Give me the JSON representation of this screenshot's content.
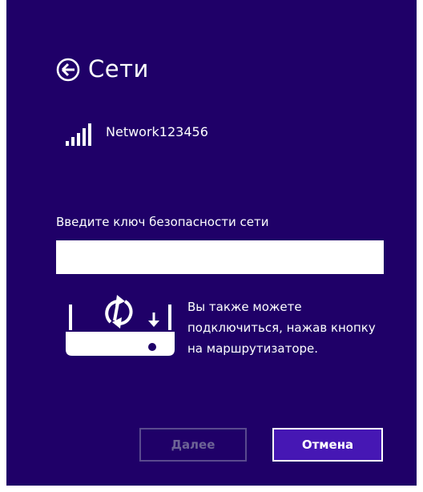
{
  "colors": {
    "panel_bg": "#1f0068",
    "cancel_bg": "#4617b4",
    "disabled_text": "#6d6496"
  },
  "header": {
    "back_icon": "circle-arrow-left-icon",
    "title": "Сети"
  },
  "network": {
    "signal_icon": "wifi-signal-bars-icon",
    "name": "Network123456"
  },
  "security_key": {
    "label": "Введите ключ безопасности сети",
    "value": "",
    "placeholder": ""
  },
  "wps": {
    "icon": "router-wps-icon",
    "hint": "Вы также можете подключиться, нажав кнопку на маршрутизаторе."
  },
  "buttons": {
    "next_label": "Далее",
    "next_enabled": false,
    "cancel_label": "Отмена"
  }
}
